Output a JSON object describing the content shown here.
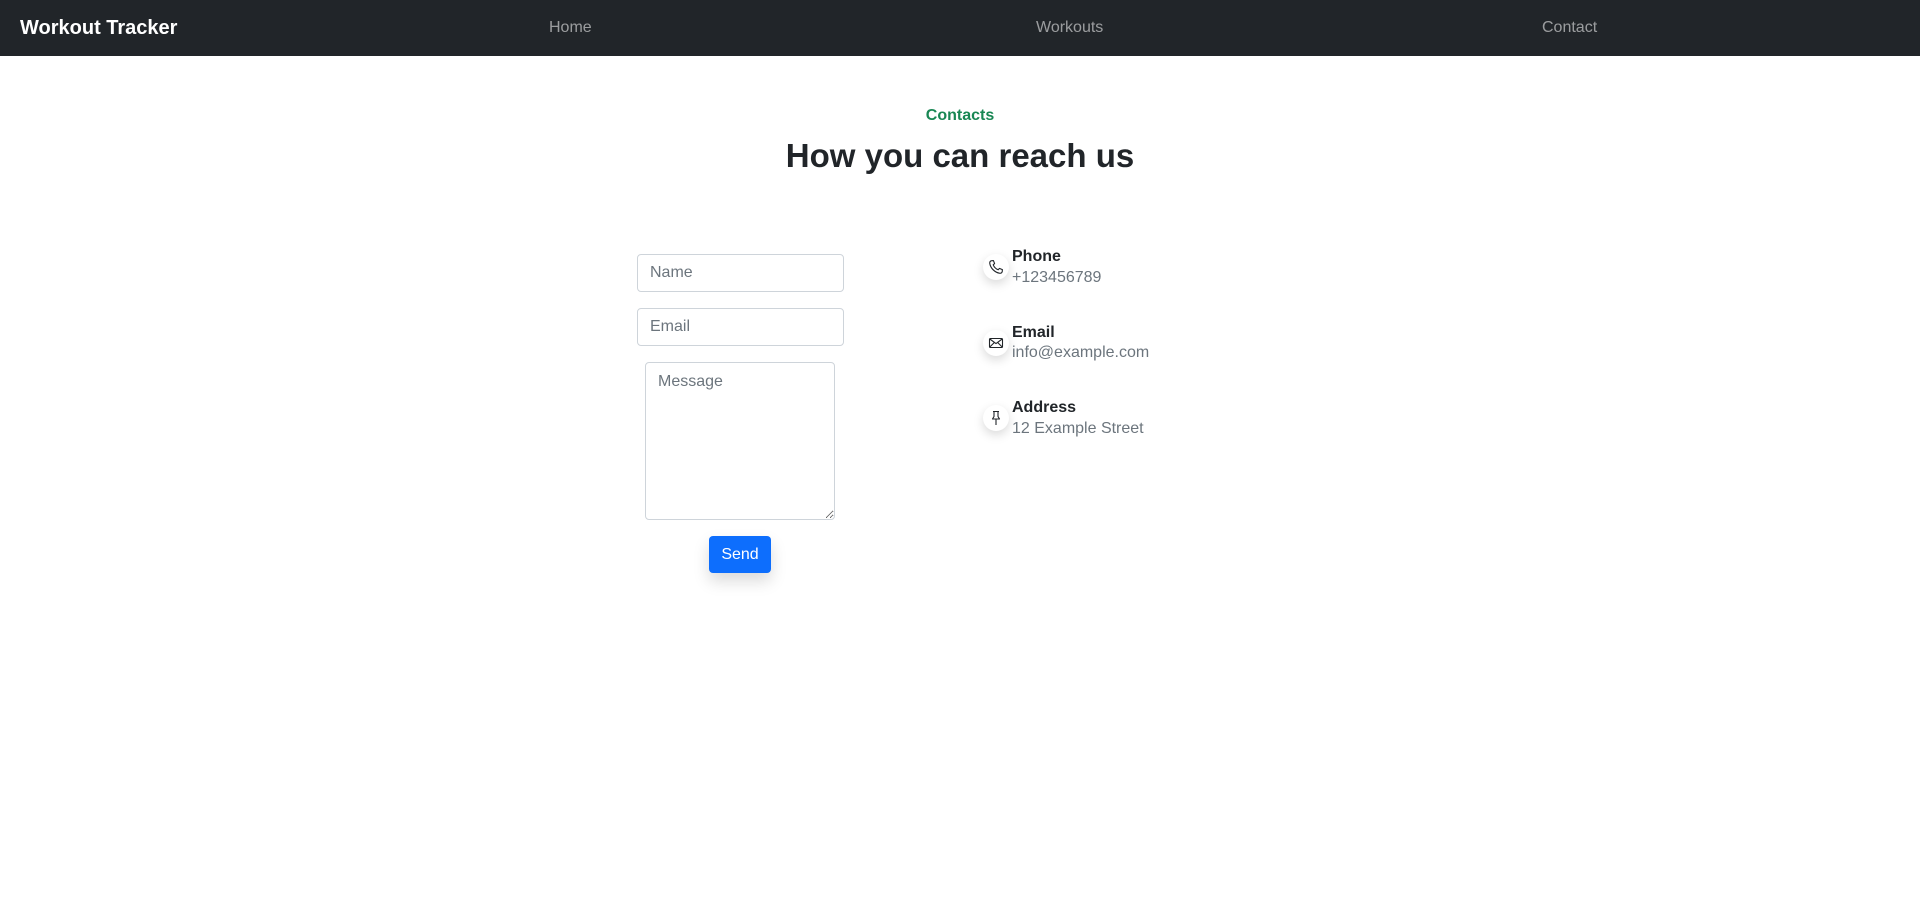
{
  "navbar": {
    "brand": "Workout Tracker",
    "links": [
      "Home",
      "Workouts",
      "Contact"
    ]
  },
  "section": {
    "kicker": "Contacts",
    "title": "How you can reach us"
  },
  "form": {
    "name_placeholder": "Name",
    "email_placeholder": "Email",
    "message_placeholder": "Message",
    "send_label": "Send"
  },
  "contacts": [
    {
      "label": "Phone",
      "value": "+123456789",
      "icon": "phone-icon"
    },
    {
      "label": "Email",
      "value": "info@example.com",
      "icon": "envelope-icon"
    },
    {
      "label": "Address",
      "value": "12 Example Street",
      "icon": "pin-icon"
    }
  ],
  "colors": {
    "navbar_bg": "#212529",
    "kicker": "#198754",
    "primary": "#0d6efd"
  }
}
